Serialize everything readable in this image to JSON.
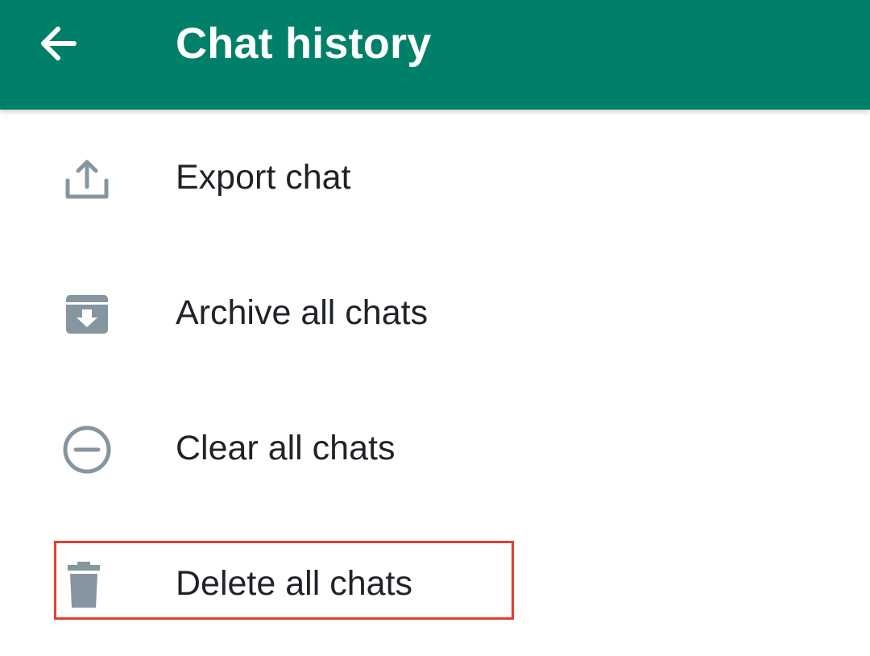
{
  "header": {
    "title": "Chat history",
    "back_icon": "back-arrow-icon",
    "background_color": "#008069"
  },
  "menu": {
    "items": [
      {
        "label": "Export chat",
        "icon": "export-icon"
      },
      {
        "label": "Archive all chats",
        "icon": "archive-icon"
      },
      {
        "label": "Clear all chats",
        "icon": "clear-icon"
      },
      {
        "label": "Delete all chats",
        "icon": "trash-icon"
      }
    ],
    "icon_color": "#8696a0",
    "text_color": "#1f2328"
  },
  "annotation": {
    "highlight_color": "#e2402f",
    "highlighted_item": "Delete all chats"
  }
}
